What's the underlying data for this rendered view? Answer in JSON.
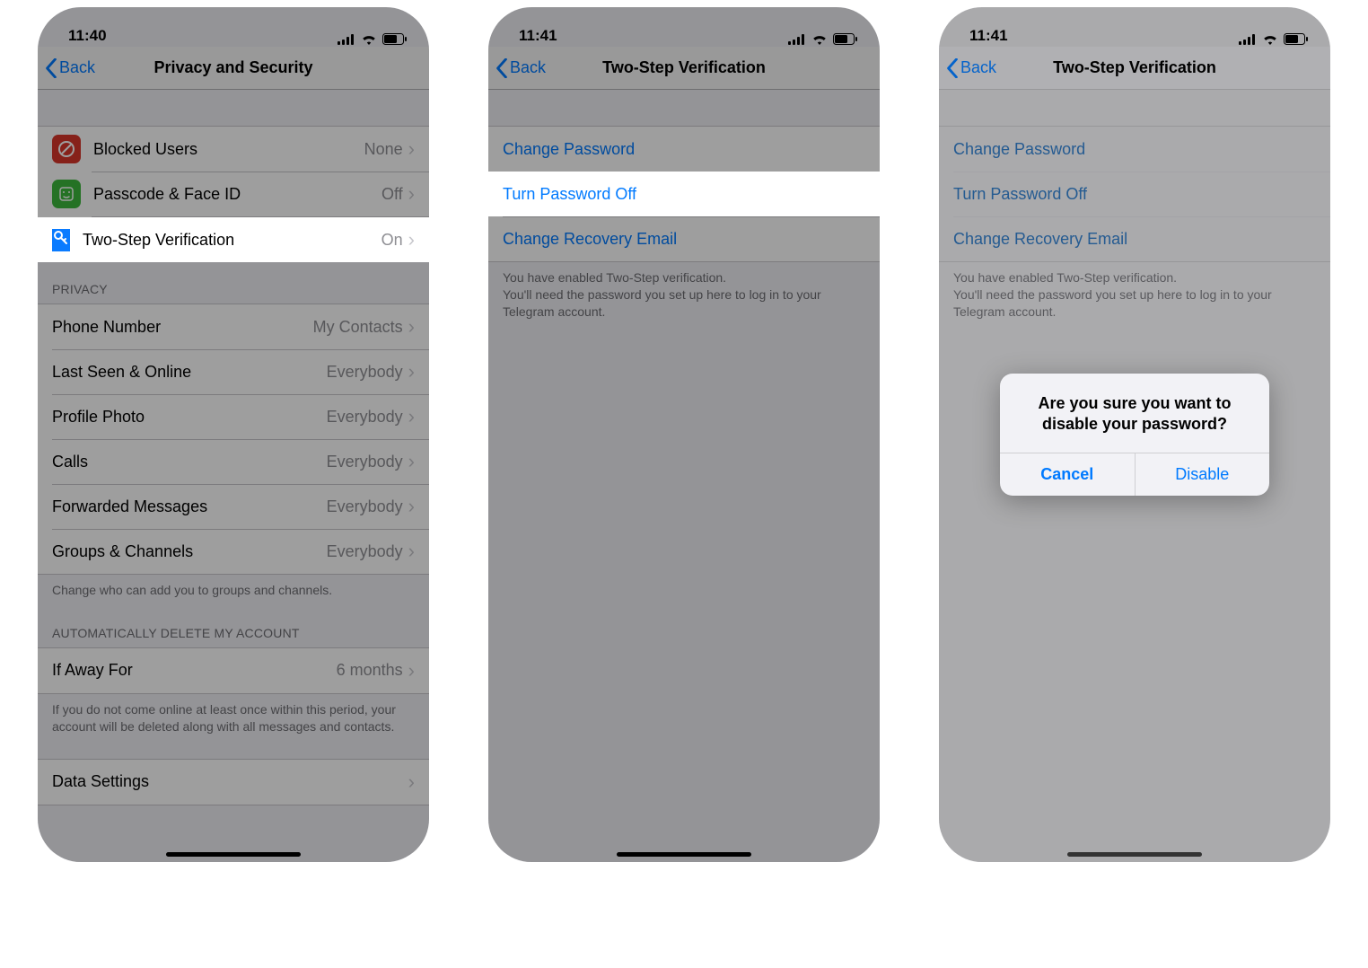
{
  "phone1": {
    "time": "11:40",
    "nav": {
      "back": "Back",
      "title": "Privacy and Security"
    },
    "security": {
      "blocked": {
        "label": "Blocked Users",
        "value": "None"
      },
      "passcode": {
        "label": "Passcode & Face ID",
        "value": "Off"
      },
      "twostep": {
        "label": "Two-Step Verification",
        "value": "On"
      }
    },
    "privacy_header": "PRIVACY",
    "privacy": {
      "phone": {
        "label": "Phone Number",
        "value": "My Contacts"
      },
      "lastseen": {
        "label": "Last Seen & Online",
        "value": "Everybody"
      },
      "photo": {
        "label": "Profile Photo",
        "value": "Everybody"
      },
      "calls": {
        "label": "Calls",
        "value": "Everybody"
      },
      "fwd": {
        "label": "Forwarded Messages",
        "value": "Everybody"
      },
      "groups": {
        "label": "Groups & Channels",
        "value": "Everybody"
      }
    },
    "privacy_footer": "Change who can add you to groups and channels.",
    "autodelete_header": "AUTOMATICALLY DELETE MY ACCOUNT",
    "autodelete": {
      "label": "If Away For",
      "value": "6 months"
    },
    "autodelete_footer": "If you do not come online at least once within this period, your account will be deleted along with all messages and contacts.",
    "data_settings": "Data Settings"
  },
  "phone2": {
    "time": "11:41",
    "nav": {
      "back": "Back",
      "title": "Two-Step Verification"
    },
    "rows": {
      "change_pw": "Change Password",
      "turn_off": "Turn Password Off",
      "change_em": "Change Recovery Email"
    },
    "footer": "You have enabled Two-Step verification.\nYou'll need the password you set up here to log in to your Telegram account."
  },
  "phone3": {
    "time": "11:41",
    "nav": {
      "back": "Back",
      "title": "Two-Step Verification"
    },
    "rows": {
      "change_pw": "Change Password",
      "turn_off": "Turn Password Off",
      "change_em": "Change Recovery Email"
    },
    "footer": "You have enabled Two-Step verification.\nYou'll need the password you set up here to log in to your Telegram account.",
    "alert": {
      "title": "Are you sure you want to disable your password?",
      "cancel": "Cancel",
      "disable": "Disable"
    }
  }
}
